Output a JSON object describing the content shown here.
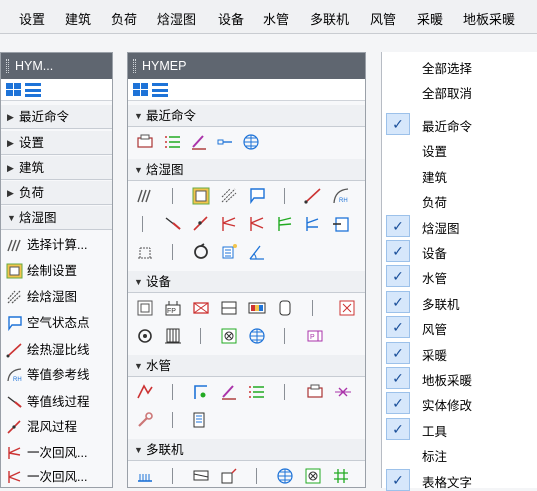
{
  "menubar": {
    "items": [
      "设置",
      "建筑",
      "负荷",
      "焓湿图",
      "设备",
      "水管",
      "多联机",
      "风管",
      "采暖",
      "地板采暖"
    ]
  },
  "left_panel": {
    "title": "HYM...",
    "categories": [
      {
        "label": "最近命令",
        "expanded": false
      },
      {
        "label": "设置",
        "expanded": false
      },
      {
        "label": "建筑",
        "expanded": false
      },
      {
        "label": "负荷",
        "expanded": false
      },
      {
        "label": "焓湿图",
        "expanded": true
      }
    ],
    "commands": [
      {
        "label": "选择计算...",
        "icon": "select-calc-icon"
      },
      {
        "label": "绘制设置",
        "icon": "draw-settings-icon"
      },
      {
        "label": "绘焓湿图",
        "icon": "draw-chart-icon"
      },
      {
        "label": "空气状态点",
        "icon": "air-state-point-icon"
      },
      {
        "label": "绘热湿比线",
        "icon": "heat-moisture-ratio-icon"
      },
      {
        "label": "等值参考线",
        "icon": "iso-reference-line-icon"
      },
      {
        "label": "等值线过程",
        "icon": "iso-line-process-icon"
      },
      {
        "label": "混风过程",
        "icon": "air-mixing-icon"
      },
      {
        "label": "一次回风...",
        "icon": "primary-return-icon"
      },
      {
        "label": "一次回风...",
        "icon": "primary-return-icon-2"
      }
    ]
  },
  "mid_panel": {
    "title": "HYMEP",
    "sections": [
      {
        "label": "最近命令"
      },
      {
        "label": "焓湿图"
      },
      {
        "label": "设备"
      },
      {
        "label": "水管"
      },
      {
        "label": "多联机"
      }
    ]
  },
  "right_panel": {
    "select_all": "全部选择",
    "deselect_all": "全部取消",
    "options": [
      {
        "label": "最近命令",
        "checked": true
      },
      {
        "label": "设置",
        "checked": false
      },
      {
        "label": "建筑",
        "checked": false
      },
      {
        "label": "负荷",
        "checked": false
      },
      {
        "label": "焓湿图",
        "checked": true
      },
      {
        "label": "设备",
        "checked": true
      },
      {
        "label": "水管",
        "checked": true
      },
      {
        "label": "多联机",
        "checked": true
      },
      {
        "label": "风管",
        "checked": true
      },
      {
        "label": "采暖",
        "checked": true
      },
      {
        "label": "地板采暖",
        "checked": true
      },
      {
        "label": "实体修改",
        "checked": true
      },
      {
        "label": "工具",
        "checked": true
      },
      {
        "label": "标注",
        "checked": false
      },
      {
        "label": "表格文字",
        "checked": true
      }
    ],
    "check_glyph": "✓"
  },
  "colors": {
    "accent": "#1e73d8",
    "title_bar": "#5f6670",
    "check_bg": "#d6e7fb"
  }
}
